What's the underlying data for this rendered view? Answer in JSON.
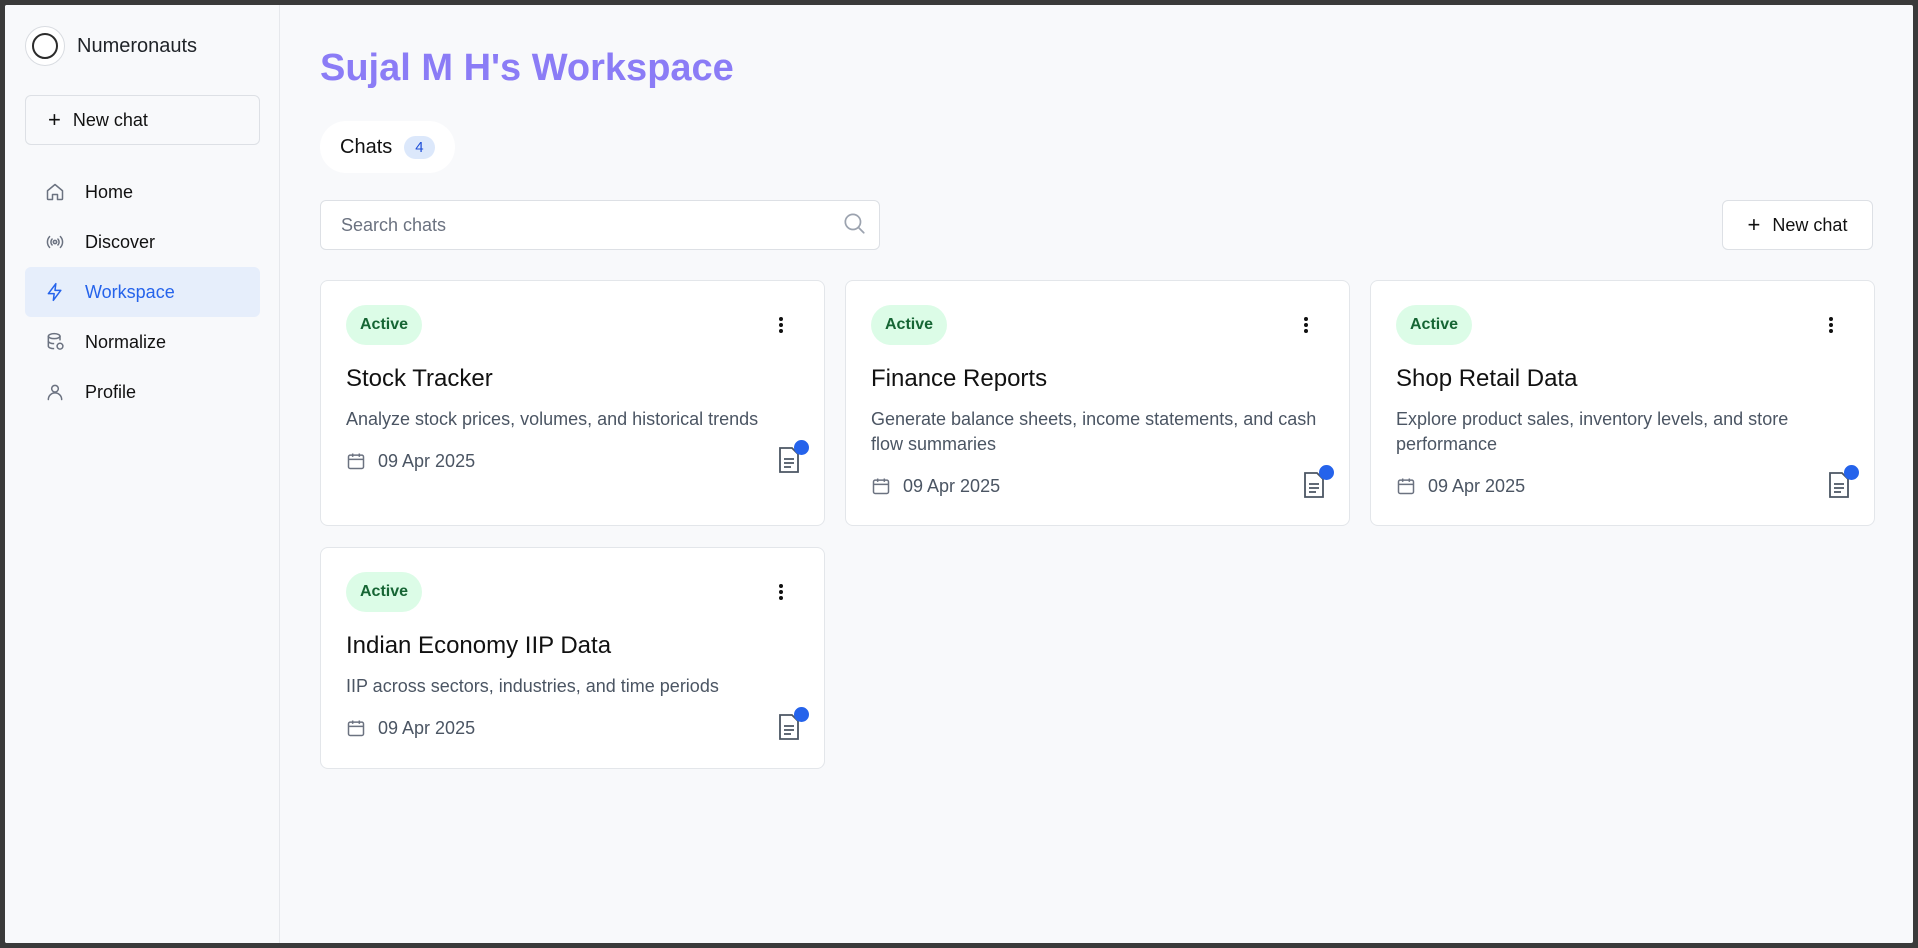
{
  "brand": {
    "name": "Numeronauts"
  },
  "sidebar": {
    "new_chat_label": "New chat",
    "items": [
      {
        "label": "Home",
        "icon": "home-icon",
        "active": false
      },
      {
        "label": "Discover",
        "icon": "broadcast-icon",
        "active": false
      },
      {
        "label": "Workspace",
        "icon": "lightning-icon",
        "active": true
      },
      {
        "label": "Normalize",
        "icon": "database-icon",
        "active": false
      },
      {
        "label": "Profile",
        "icon": "user-icon",
        "active": false
      }
    ]
  },
  "main": {
    "title": "Sujal M H's Workspace",
    "tab": {
      "label": "Chats",
      "count": "4"
    },
    "search": {
      "placeholder": "Search chats",
      "value": ""
    },
    "new_chat_label": "New chat",
    "cards": [
      {
        "status": "Active",
        "title": "Stock Tracker",
        "description": "Analyze stock prices, volumes, and historical trends",
        "date": "09 Apr 2025"
      },
      {
        "status": "Active",
        "title": "Finance Reports",
        "description": "Generate balance sheets, income statements, and cash flow summaries",
        "date": "09 Apr 2025"
      },
      {
        "status": "Active",
        "title": "Shop Retail Data",
        "description": "Explore product sales, inventory levels, and store performance",
        "date": "09 Apr 2025"
      },
      {
        "status": "Active",
        "title": "Indian Economy IIP Data",
        "description": "IIP across sectors, industries, and time periods",
        "date": "09 Apr 2025"
      }
    ]
  },
  "colors": {
    "accent": "#2563eb",
    "title": "#8b7cf6",
    "badge_bg": "#dcfce7",
    "badge_text": "#166534"
  }
}
